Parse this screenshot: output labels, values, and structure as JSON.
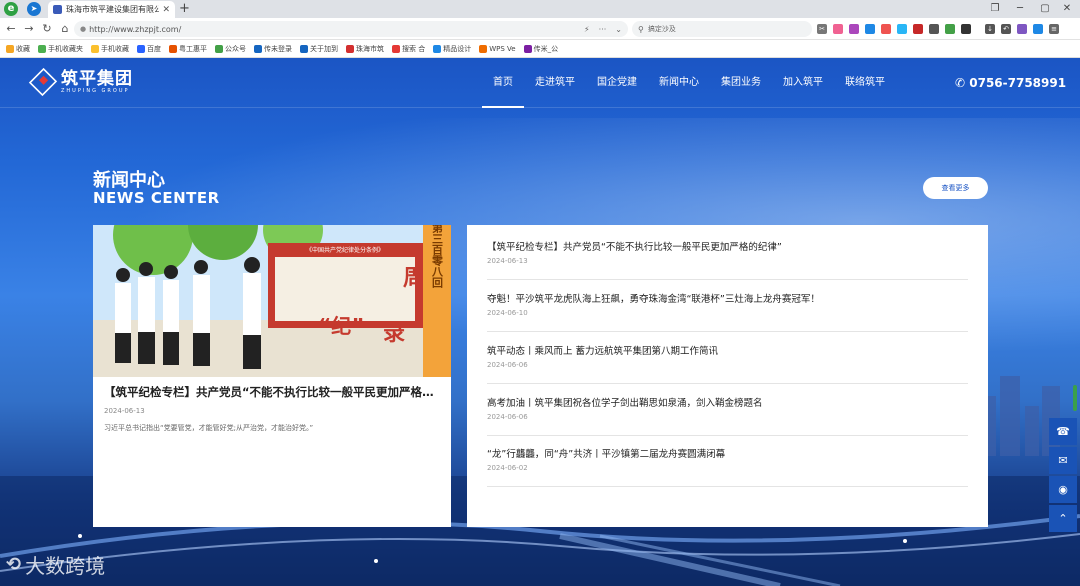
{
  "browser": {
    "tab_title": "珠海市筑平建设集团有限公司",
    "url": "http://www.zhzpjt.com/",
    "search_placeholder": "搞定沙及"
  },
  "bookmarks": [
    "收藏",
    "手机收藏夹",
    "手机收藏",
    "百度",
    "粤工惠平",
    "公众号",
    "传未登录",
    "关于加到",
    "珠海市筑",
    "搜索 合",
    "精品设计",
    "WPS Ve",
    "传米_公"
  ],
  "site": {
    "logo_cn": "筑平集团",
    "logo_en": "ZHUPING GROUP",
    "menu": [
      "首页",
      "走进筑平",
      "国企党建",
      "新闻中心",
      "集团业务",
      "加入筑平",
      "联络筑平"
    ],
    "phone": "0756-7758991"
  },
  "news": {
    "title_cn": "新闻中心",
    "title_en": "NEWS CENTER",
    "more": "查看更多",
    "featured": {
      "title": "【筑平纪检专栏】共产党员“不能不执行比较一般平民更加严格的纪律”",
      "date": "2024-06-13",
      "summary": "习近平总书记指出“党要管党，才能管好党;从严治党，才能治好党。”",
      "img_banner": "《中国共产党纪律处分条例》",
      "img_week": "周",
      "img_ji": "“纪”",
      "img_lu": "录",
      "img_side": "第三百零八回"
    },
    "items": [
      {
        "title": "【筑平纪检专栏】共产党员“不能不执行比较一般平民更加严格的纪律”",
        "date": "2024-06-13"
      },
      {
        "title": "夺魁！平沙筑平龙虎队海上狂飙，勇夺珠海金湾“联港杯”三灶海上龙舟赛冠军！",
        "date": "2024-06-10"
      },
      {
        "title": "筑平动态丨乘风而上 蓄力远航筑平集团第八期工作简讯",
        "date": "2024-06-06"
      },
      {
        "title": "高考加油丨筑平集团祝各位学子剑出鞘思如泉涌，剑入鞘金榜题名",
        "date": "2024-06-06"
      },
      {
        "title": "“龙”行龘龘，同“舟”共济丨平沙镇第二届龙舟赛圆满闭幕",
        "date": "2024-06-02"
      }
    ]
  },
  "watermark": "大数跨境"
}
